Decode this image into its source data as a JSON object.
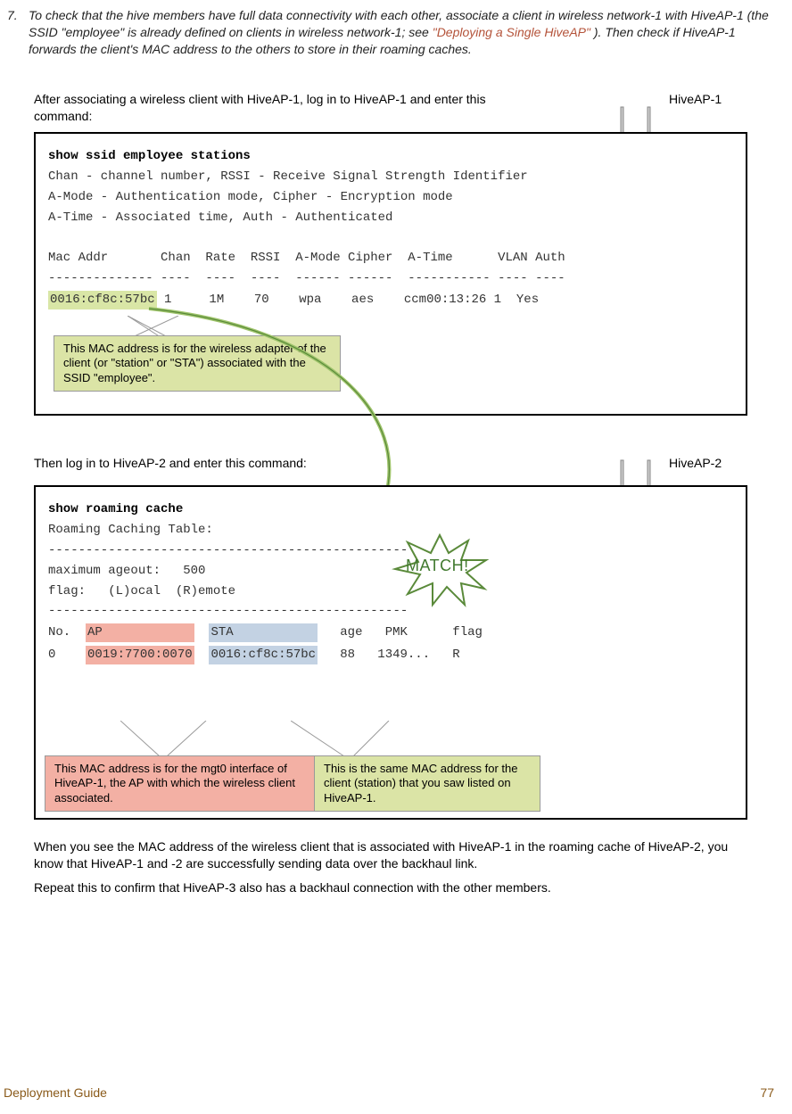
{
  "step": {
    "num": "7.",
    "text_a": "To check that the hive members have full data connectivity with each other, associate a client in wireless network-1 with HiveAP-1 (the SSID \"employee\" is already defined on clients in wireless network-1; see ",
    "link": "\"Deploying a Single HiveAP\"",
    "text_b": "). Then check if HiveAP-1 forwards the client's MAC address to the others to store in their roaming caches."
  },
  "intro1": "After associating a wireless client with HiveAP-1, log in to HiveAP-1 and enter this command:",
  "ap1": "HiveAP-1",
  "term1": {
    "cmd": "show ssid employee stations",
    "l1": "Chan - channel number, RSSI - Receive Signal Strength Identifier",
    "l2": "A-Mode - Authentication mode, Cipher - Encryption mode",
    "l3": "A-Time - Associated time, Auth - Authenticated",
    "hdr": "Mac Addr       Chan  Rate  RSSI  A-Mode Cipher  A-Time      VLAN Auth",
    "sep": "-------------- ----  ----  ----  ------ ------  ----------- ---- ----",
    "mac": "0016:cf8c:57bc",
    "rest": " 1     1M    70    wpa    aes    ccm00:13:26 1  Yes"
  },
  "c1": "This MAC address is for the wireless adapter of the client (or \"station\" or \"STA\") associated with the SSID \"employee\".",
  "intro2": "Then log in to HiveAP-2 and enter this command:",
  "ap2": "HiveAP-2",
  "term2": {
    "cmd": "show roaming cache",
    "l1": "Roaming Caching Table:",
    "sep1": "------------------------------------------------",
    "l2": "maximum ageout:   500",
    "l3": "flag:   (L)ocal  (R)emote",
    "sep2": "------------------------------------------------",
    "hdr_a": "No.  ",
    "hdr_ap": "AP            ",
    "hdr_s": "  ",
    "hdr_sta": "STA           ",
    "hdr_b": "   age   PMK      flag",
    "row_a": "0    ",
    "row_ap": "0019:7700:0070",
    "row_s": "  ",
    "row_sta": "0016:cf8c:57bc",
    "row_b": "   88   1349...   R"
  },
  "match": "MATCH!",
  "c2": "This MAC address is for the mgt0 interface of HiveAP-1, the AP with which the wireless client associated.",
  "c3": "This is the same MAC address for the client (station) that you saw listed on HiveAP-1.",
  "body1": "When you see the MAC address of the wireless client that is associated with HiveAP-1 in the roaming cache of HiveAP-2, you know that HiveAP-1 and -2 are successfully sending data over the backhaul link.",
  "body2": "Repeat this to confirm that HiveAP-3 also has a backhaul connection with the other members.",
  "footer": {
    "left": "Deployment Guide",
    "right": "77"
  }
}
